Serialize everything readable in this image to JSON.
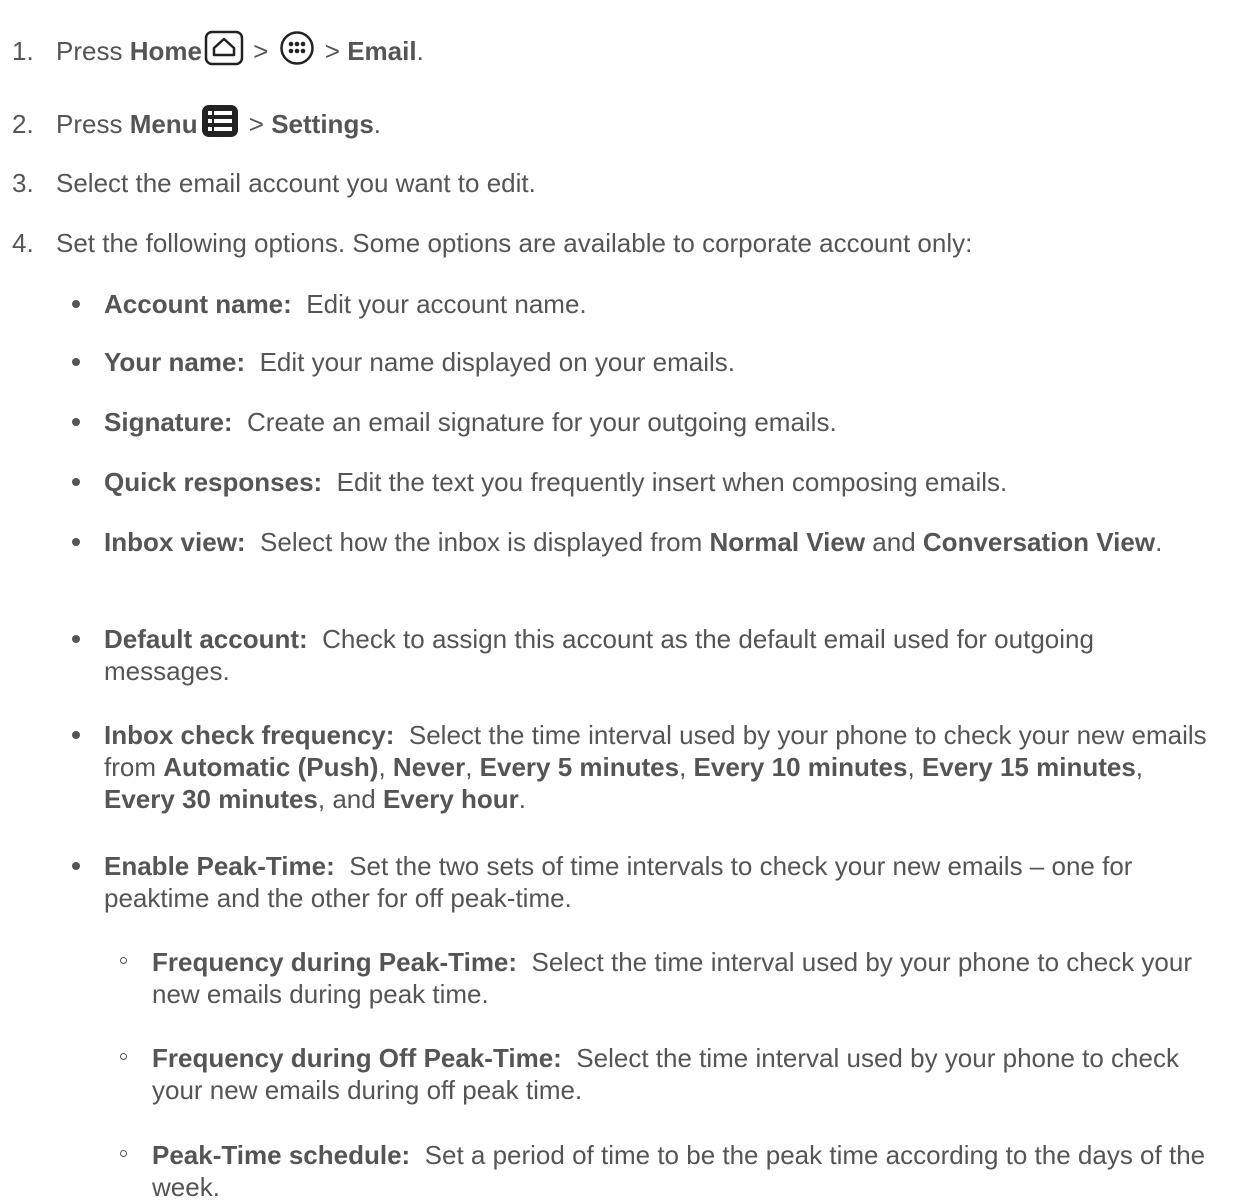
{
  "steps": [
    {
      "num": "1.",
      "prefix": "Press ",
      "home_label": "Home",
      "sep1": " > ",
      "sep2": " > ",
      "email_label": "Email",
      "suffix": "."
    },
    {
      "num": "2.",
      "prefix": "Press ",
      "menu_label": "Menu",
      "sep1": " > ",
      "settings_label": "Settings",
      "suffix": "."
    },
    {
      "num": "3.",
      "text": "Select the email account you want to edit."
    },
    {
      "num": "4.",
      "text": "Set the following options. Some options are available to corporate account only:"
    }
  ],
  "options": [
    {
      "label": "Account name:",
      "text": "Edit your account name."
    },
    {
      "label": "Your name:",
      "text": "Edit your name displayed on your emails."
    },
    {
      "label": "Signature:",
      "text": "Create an email signature for your outgoing emails."
    },
    {
      "label": "Quick responses:",
      "text": "Edit the text you frequently insert when composing emails."
    },
    {
      "label": "Inbox view:",
      "text": "Select how the inbox is displayed from ",
      "b1": "Normal View",
      "t2": " and ",
      "b2": "Conversation View",
      "t3": "."
    },
    {
      "label": "Default account:",
      "text": "Check to assign this account as the default email used for outgoing messages."
    },
    {
      "label": "Inbox check frequency:",
      "text": "Select the time interval used by your phone to check your new emails from ",
      "values": [
        "Automatic (Push)",
        "Never",
        "Every 5 minutes",
        "Every 10 minutes",
        "Every 15 minutes",
        "Every 30 minutes",
        "Every hour"
      ],
      "sep": ", ",
      "and": ", and ",
      "end": "."
    },
    {
      "label": "Enable Peak-Time:",
      "text": "Set the two sets of time intervals to check your new emails – one for peaktime and the other for off peak-time."
    }
  ],
  "suboptions": [
    {
      "label": "Frequency during Peak-Time:",
      "text": "Select the time interval used by your phone to check your new emails during peak time."
    },
    {
      "label": "Frequency during Off Peak-Time:",
      "text": "Select the time interval used by your phone to check your new emails during off peak time."
    },
    {
      "label": "Peak-Time schedule:",
      "text": "Set a period of time to be the peak time according to the days of the week."
    }
  ],
  "icons": {
    "home": "home-key-icon",
    "apps": "all-apps-icon",
    "menu": "menu-key-icon"
  }
}
